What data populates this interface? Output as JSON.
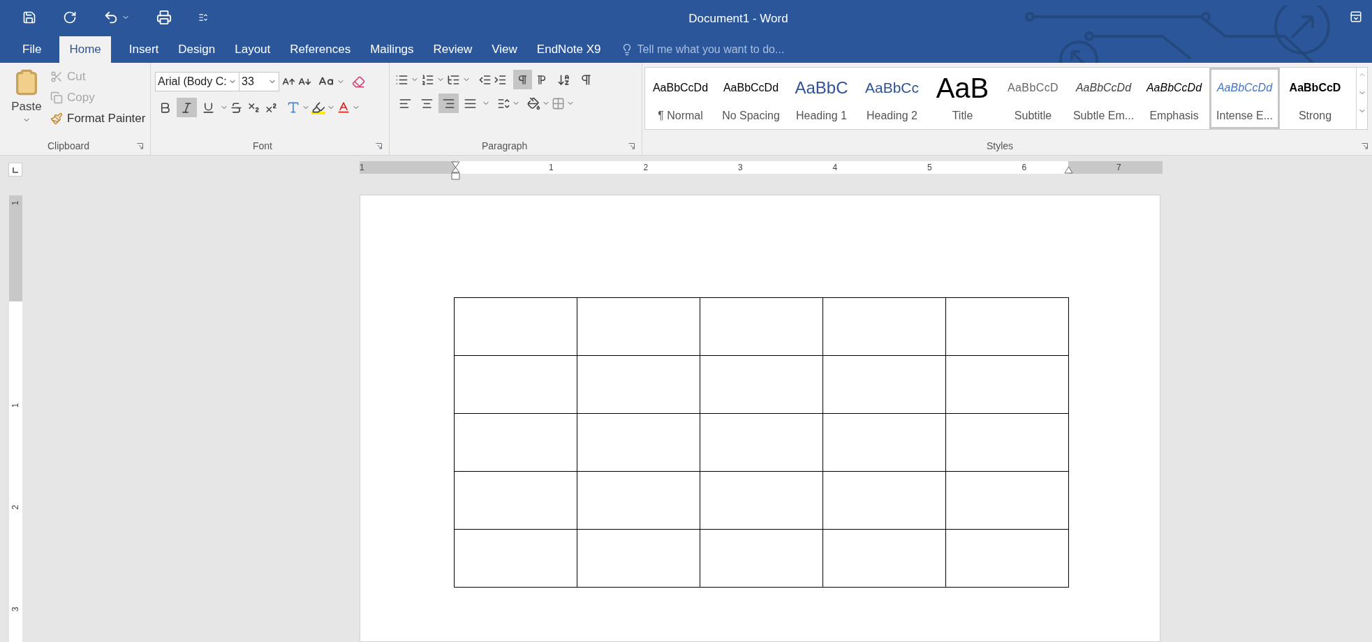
{
  "quick_access": [
    {
      "kind": "save"
    },
    {
      "kind": "redo"
    },
    {
      "kind": "undo"
    },
    {
      "kind": "touch"
    },
    {
      "kind": "customize"
    }
  ],
  "window": {
    "title": "Document1 - Word"
  },
  "tabs": [
    {
      "label": "File",
      "selected": false
    },
    {
      "label": "Home",
      "selected": true
    },
    {
      "label": "Insert",
      "selected": false
    },
    {
      "label": "Design",
      "selected": false
    },
    {
      "label": "Layout",
      "selected": false
    },
    {
      "label": "References",
      "selected": false
    },
    {
      "label": "Mailings",
      "selected": false
    },
    {
      "label": "Review",
      "selected": false
    },
    {
      "label": "View",
      "selected": false
    },
    {
      "label": "EndNote X9",
      "selected": false
    }
  ],
  "tell_me": {
    "placeholder": "Tell me what you want to do..."
  },
  "clipboard": {
    "label": "Clipboard",
    "paste": "Paste",
    "items": [
      {
        "kind": "cut",
        "label": "Cut",
        "disabled": true
      },
      {
        "kind": "copy",
        "label": "Copy",
        "disabled": true
      },
      {
        "kind": "painter",
        "label": "Format Painter",
        "disabled": false
      }
    ]
  },
  "font": {
    "label": "Font",
    "font_name": "Arial (Body C:",
    "font_size": "33",
    "toggles": [
      {
        "kind": "bold",
        "selected": false
      },
      {
        "kind": "italic",
        "selected": true
      },
      {
        "kind": "underline",
        "selected": false
      }
    ]
  },
  "paragraph": {
    "label": "Paragraph",
    "direction": [
      {
        "kind": "ltr",
        "selected": true
      },
      {
        "kind": "rtl",
        "selected": false
      }
    ],
    "alignment": [
      {
        "kind": "left",
        "selected": false
      },
      {
        "kind": "center",
        "selected": false
      },
      {
        "kind": "right",
        "selected": true
      },
      {
        "kind": "justify",
        "selected": false
      }
    ]
  },
  "styles": {
    "label": "Styles",
    "items": [
      {
        "kind": "normal",
        "preview": "AaBbCcDd",
        "label": "¶ Normal",
        "selected": false
      },
      {
        "kind": "normal",
        "preview": "AaBbCcDd",
        "label": "No Spacing",
        "selected": false
      },
      {
        "kind": "heading1",
        "preview": "AaBbC",
        "label": "Heading 1",
        "selected": false
      },
      {
        "kind": "heading2",
        "preview": "AaBbCc",
        "label": "Heading 2",
        "selected": false
      },
      {
        "kind": "title",
        "preview": "AaB",
        "label": "Title",
        "selected": false
      },
      {
        "kind": "subtitle",
        "preview": "AaBbCcD",
        "label": "Subtitle",
        "selected": false
      },
      {
        "kind": "subtle",
        "preview": "AaBbCcDd",
        "label": "Subtle Em...",
        "selected": false
      },
      {
        "kind": "emphasis",
        "preview": "AaBbCcDd",
        "label": "Emphasis",
        "selected": false
      },
      {
        "kind": "intense",
        "preview": "AaBbCcDd",
        "label": "Intense E...",
        "selected": true
      },
      {
        "kind": "strong",
        "preview": "AaBbCcD",
        "label": "Strong",
        "selected": false
      }
    ]
  },
  "ruler": {
    "horizontal": [
      "1",
      "1",
      "2",
      "3",
      "4",
      "5",
      "6",
      "7"
    ],
    "vertical": [
      "1",
      "1",
      "2",
      "3"
    ]
  },
  "table": {
    "rows": [
      {
        "cells": [
          {
            "kind": "empty"
          },
          {
            "kind": "empty"
          },
          {
            "kind": "empty"
          },
          {
            "kind": "empty"
          },
          {
            "kind": "empty"
          }
        ]
      },
      {
        "cells": [
          {
            "kind": "empty"
          },
          {
            "kind": "empty"
          },
          {
            "kind": "empty"
          },
          {
            "kind": "empty"
          },
          {
            "kind": "empty"
          }
        ]
      },
      {
        "cells": [
          {
            "kind": "empty"
          },
          {
            "kind": "empty"
          },
          {
            "kind": "empty"
          },
          {
            "kind": "empty"
          },
          {
            "kind": "empty"
          }
        ]
      },
      {
        "cells": [
          {
            "kind": "empty"
          },
          {
            "kind": "empty"
          },
          {
            "kind": "empty"
          },
          {
            "kind": "empty"
          },
          {
            "kind": "empty"
          }
        ]
      },
      {
        "cells": [
          {
            "kind": "empty"
          },
          {
            "kind": "empty"
          },
          {
            "kind": "empty"
          },
          {
            "kind": "empty"
          },
          {
            "kind": "empty"
          }
        ]
      }
    ]
  }
}
